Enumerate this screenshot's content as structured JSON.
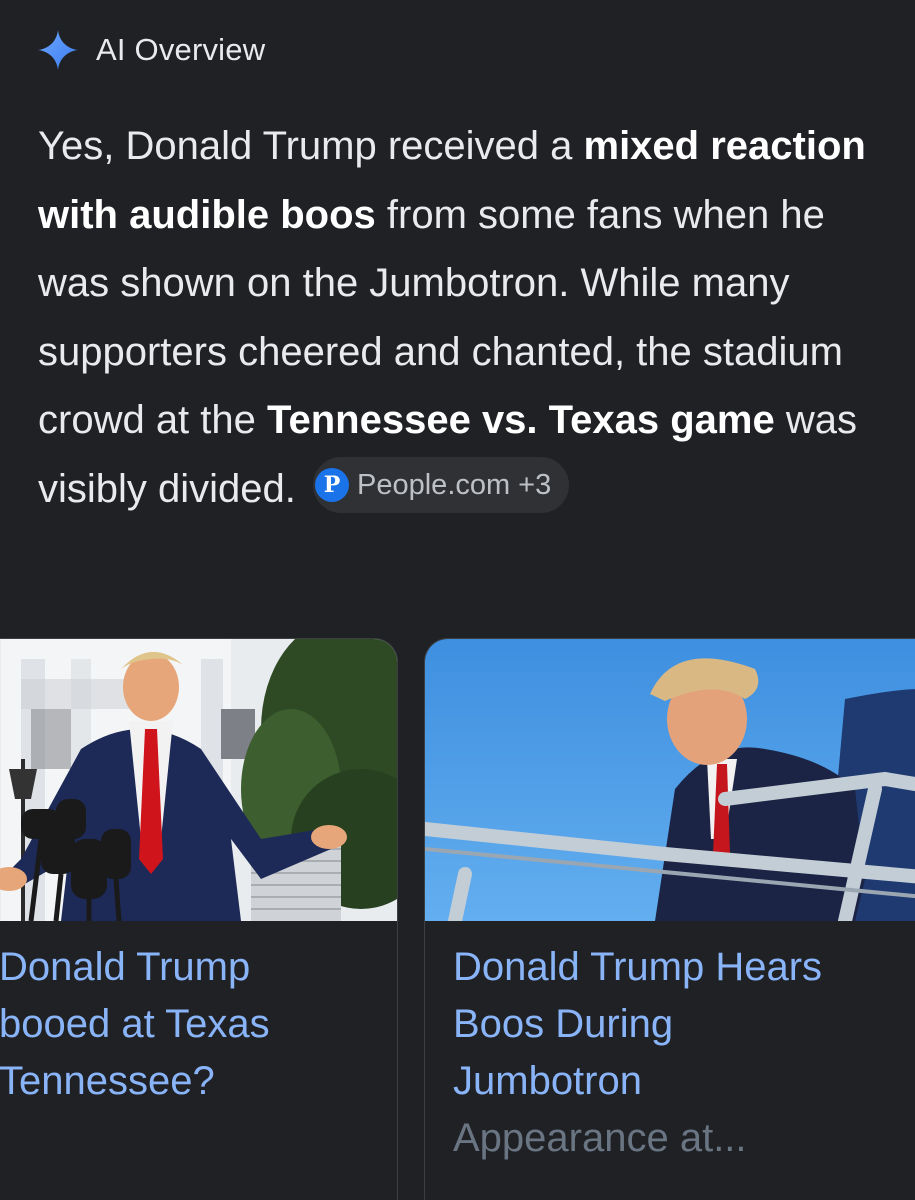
{
  "header": {
    "icon": "sparkle-icon",
    "title": "AI Overview"
  },
  "overview": {
    "segments": [
      {
        "text": "Yes, Donald Trump received a ",
        "bold": false
      },
      {
        "text": "mixed reaction with audible boos",
        "bold": true
      },
      {
        "text": " from some fans when he was shown on the Jumbotron. While many supporters cheered and chanted, the stadium crowd at the ",
        "bold": false
      },
      {
        "text": "Tennessee vs. Texas game",
        "bold": true
      },
      {
        "text": " was visibly divided.",
        "bold": false
      }
    ],
    "source_chip": {
      "logo_letter": "P",
      "name": "People.com",
      "count": "+3"
    }
  },
  "cards": [
    {
      "title": "Donald Trump booed at Texas Tennessee?",
      "title_lines": [
        "Donald Trump",
        "booed at Texas",
        "Tennessee?"
      ]
    },
    {
      "title": "Donald Trump Hears Boos During Jumbotron Appearance at...",
      "title_lines": [
        "Donald Trump Hears",
        "Boos During",
        "Jumbotron"
      ],
      "title_faded": "Appearance at..."
    }
  ],
  "colors": {
    "background": "#202125",
    "text": "#e8eaed",
    "link": "#8ab4f8",
    "chip_bg": "#303134",
    "sparkle": "#4a8ff7"
  }
}
